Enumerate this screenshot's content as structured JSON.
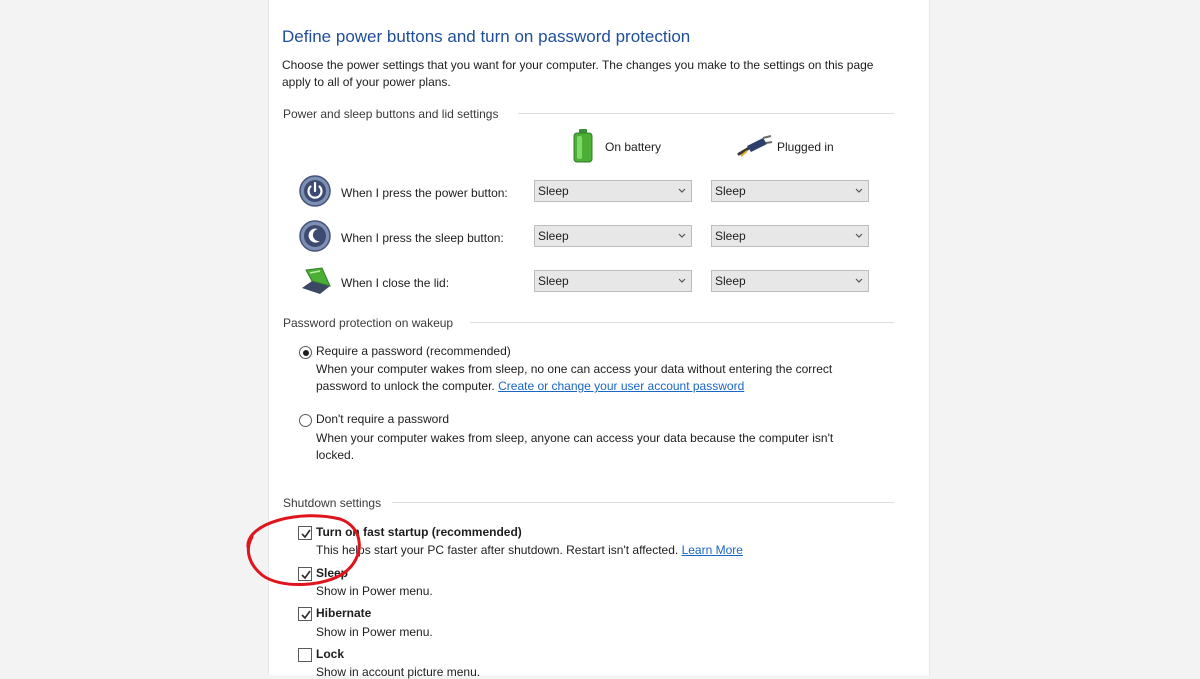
{
  "page": {
    "title": "Define power buttons and turn on password protection",
    "intro": "Choose the power settings that you want for your computer. The changes you make to the settings on this page apply to all of your power plans."
  },
  "buttons_section": {
    "heading": "Power and sleep buttons and lid settings",
    "col_battery": "On battery",
    "col_plugged": "Plugged in",
    "rows": [
      {
        "label": "When I press the power button:",
        "battery": "Sleep",
        "plugged": "Sleep",
        "icon": "power-button-icon"
      },
      {
        "label": "When I press the sleep button:",
        "battery": "Sleep",
        "plugged": "Sleep",
        "icon": "sleep-button-icon"
      },
      {
        "label": "When I close the lid:",
        "battery": "Sleep",
        "plugged": "Sleep",
        "icon": "laptop-lid-icon"
      }
    ]
  },
  "password_section": {
    "heading": "Password protection on wakeup",
    "require_label": "Require a password (recommended)",
    "require_desc_1": "When your computer wakes from sleep, no one can access your data without entering the correct",
    "require_desc_2": "password to unlock the computer.",
    "require_link": "Create or change your user account password",
    "no_require_label": "Don't require a password",
    "no_require_desc_1": "When your computer wakes from sleep, anyone can access your data because the computer isn't",
    "no_require_desc_2": "locked.",
    "selected": "require"
  },
  "shutdown_section": {
    "heading": "Shutdown settings",
    "items": [
      {
        "label": "Turn on fast startup (recommended)",
        "desc": "This helps start your PC faster after shutdown. Restart isn't affected.",
        "link": "Learn More",
        "checked": true
      },
      {
        "label": "Sleep",
        "desc": "Show in Power menu.",
        "checked": true
      },
      {
        "label": "Hibernate",
        "desc": "Show in Power menu.",
        "checked": true
      },
      {
        "label": "Lock",
        "desc": "Show in account picture menu.",
        "checked": false
      }
    ]
  },
  "colors": {
    "title_blue": "#1f4e99",
    "link_blue": "#1a66c5",
    "annotation_red": "#e0141c"
  }
}
